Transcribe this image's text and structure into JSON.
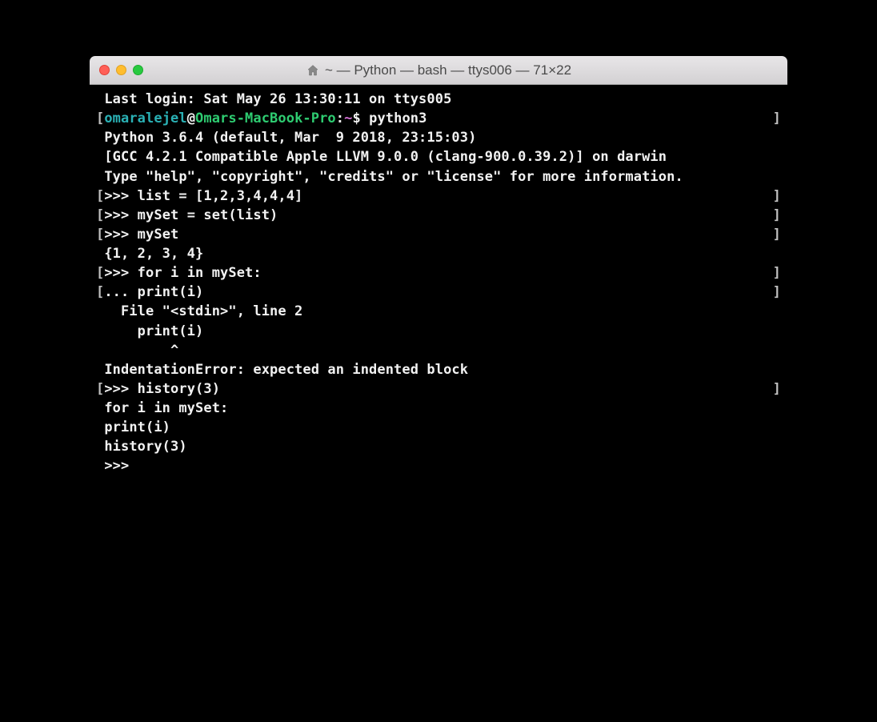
{
  "titlebar": {
    "title": "~ — Python — bash — ttys006 — 71×22"
  },
  "colors": {
    "user": "#2ab1b5",
    "host": "#2ecc71",
    "tilde": "#d670d6"
  },
  "prompt": {
    "user": "omaralejel",
    "at": "@",
    "host": "Omars-MacBook-Pro",
    "sep": ":",
    "tilde": "~",
    "dollar": "$ ",
    "command": "python3"
  },
  "lines": {
    "last_login": " Last login: Sat May 26 13:30:11 on ttys005",
    "python_version": " Python 3.6.4 (default, Mar  9 2018, 23:15:03) ",
    "gcc_line": " [GCC 4.2.1 Compatible Apple LLVM 9.0.0 (clang-900.0.39.2)] on darwin",
    "help_line": " Type \"help\", \"copyright\", \"credits\" or \"license\" for more information.",
    "list_assign": ">>> list = [1,2,3,4,4,4]",
    "set_assign": ">>> mySet = set(list)",
    "myset_eval": ">>> mySet",
    "myset_result": " {1, 2, 3, 4}",
    "for_loop": ">>> for i in mySet:",
    "print_cont": "... print(i)",
    "file_stdin": "   File \"<stdin>\", line 2",
    "print_err": "     print(i)",
    "caret": "         ^",
    "indent_error": " IndentationError: expected an indented block",
    "history_call": ">>> history(3)",
    "hist_for": " for i in mySet:",
    "hist_print": " print(i)",
    "hist_history": " history(3)",
    "final_prompt": " >>> "
  },
  "brackets": {
    "left": "[",
    "right": "]"
  }
}
